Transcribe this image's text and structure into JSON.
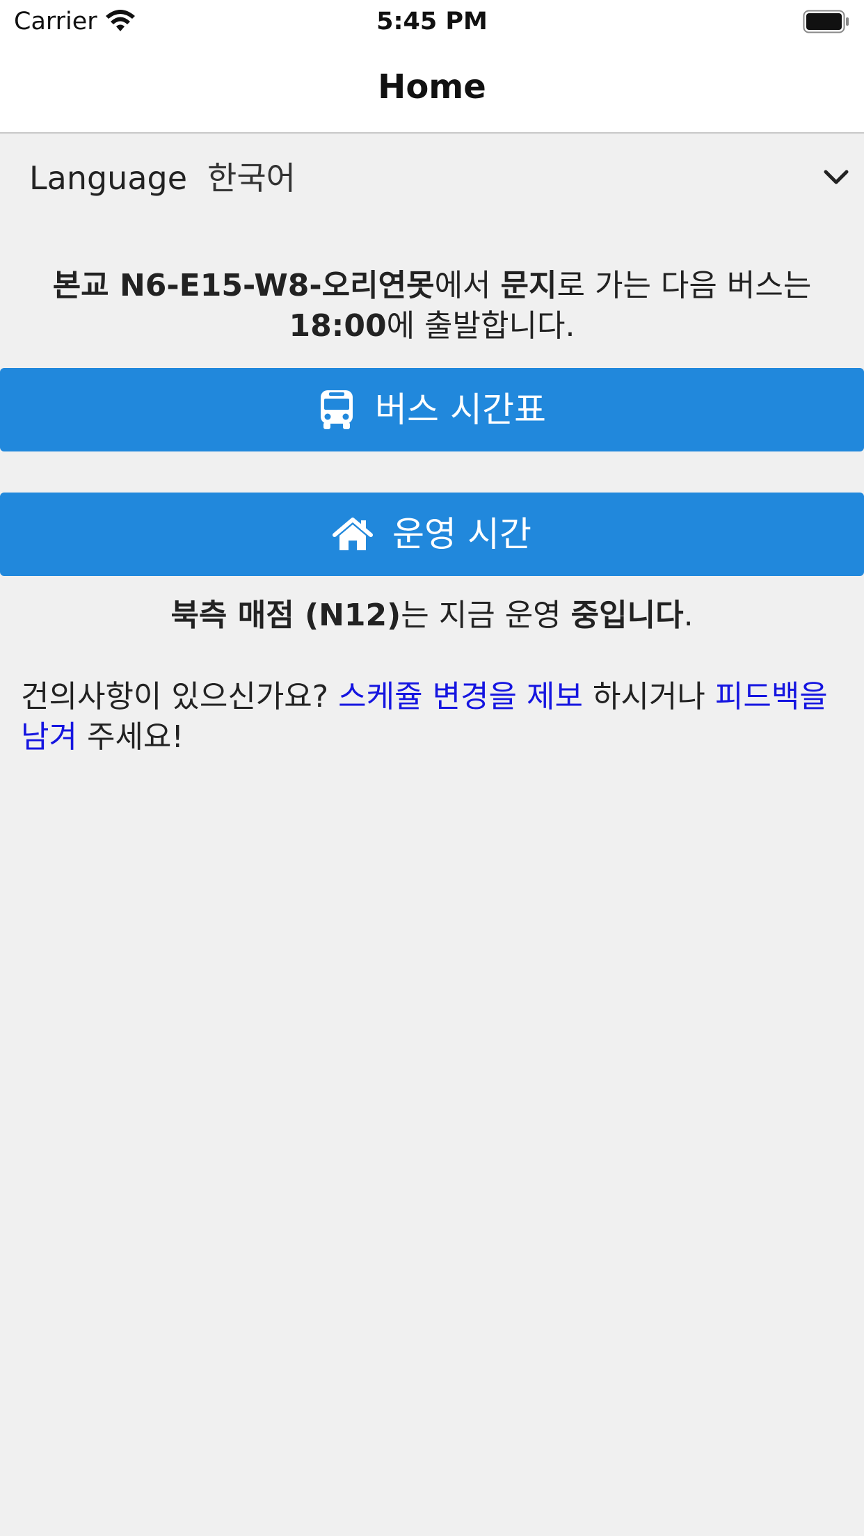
{
  "status_bar": {
    "carrier": "Carrier",
    "time": "5:45 PM",
    "icons": [
      "wifi-icon",
      "battery-icon"
    ]
  },
  "nav": {
    "title": "Home"
  },
  "language": {
    "label": "Language",
    "value": "한국어",
    "icon": "chevron-down-icon"
  },
  "next_bus": {
    "origin": "본교 N6-E15-W8-오리연못",
    "part1": "에서 ",
    "destination": "문지",
    "part2": "로 가는 다음 버스는 ",
    "time": "18:00",
    "part3": "에 출발합니다."
  },
  "buttons": {
    "schedule": {
      "label": "버스 시간표",
      "icon": "bus-icon"
    },
    "hours": {
      "label": "운영 시간",
      "icon": "home-icon"
    }
  },
  "store_status": {
    "store": "북측 매점 (N12)",
    "middle": "는 지금 운영 ",
    "state": "중입니다",
    "end": "."
  },
  "feedback": {
    "prefix": "건의사항이 있으신가요? ",
    "report_link": "스케쥴 변경을 제보",
    "middle": " 하시거나 ",
    "feedback_link": "피드백을 남겨",
    "suffix": " 주세요!"
  },
  "colors": {
    "accent": "#2188dc",
    "link": "#1515e0",
    "background": "#f0f0f0"
  }
}
